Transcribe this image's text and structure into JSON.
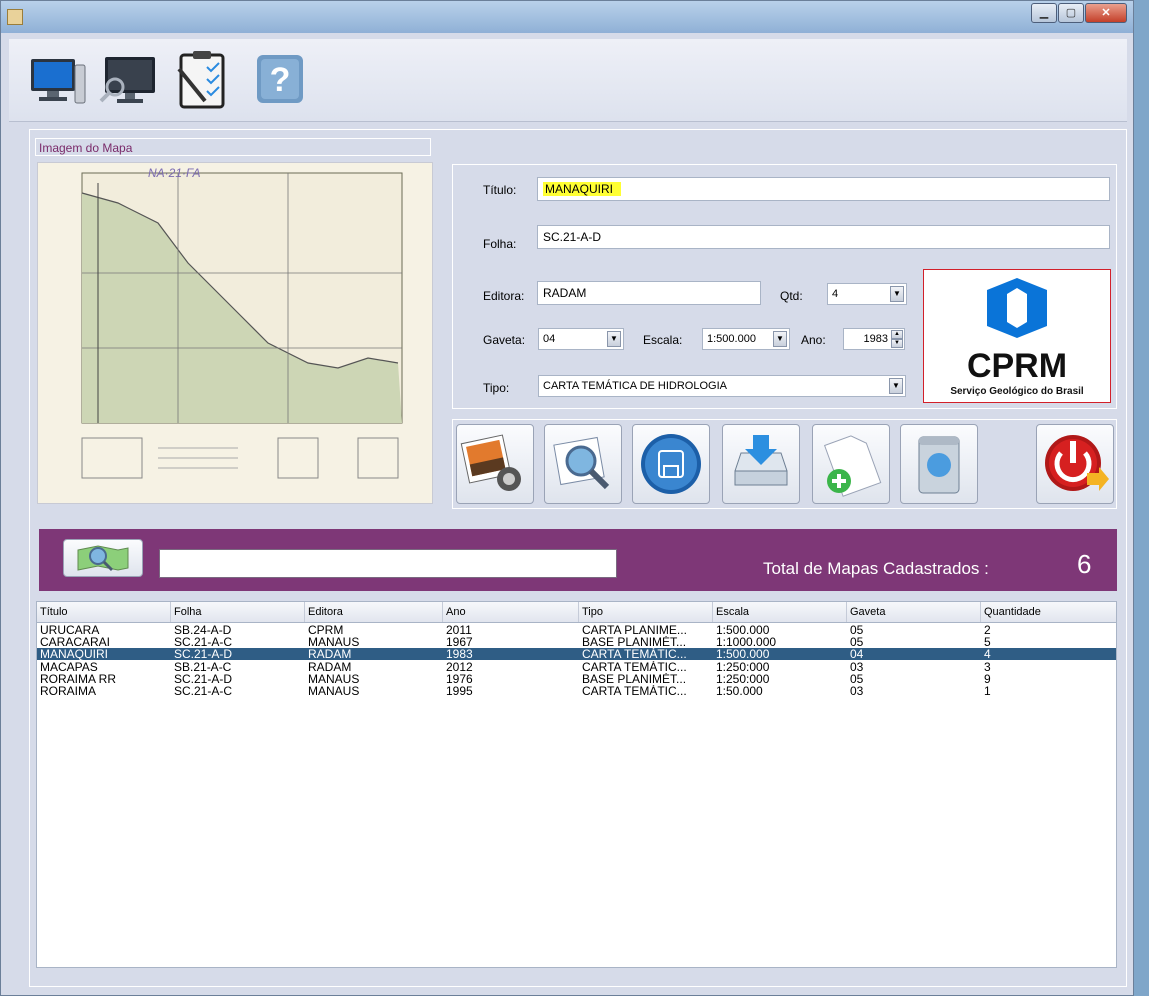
{
  "toolbar": {
    "icons": [
      "desktop-monitor-icon",
      "monitor-search-icon",
      "clipboard-checklist-icon",
      "help-icon"
    ]
  },
  "map_panel": {
    "label": "Imagem do Mapa",
    "sheet_code_handwritten": "NA·21·FA"
  },
  "form": {
    "titulo_label": "Título:",
    "titulo_value": "MANAQUIRI",
    "folha_label": "Folha:",
    "folha_value": "SC.21-A-D",
    "editora_label": "Editora:",
    "editora_value": "RADAM",
    "qtd_label": "Qtd:",
    "qtd_value": "4",
    "gaveta_label": "Gaveta:",
    "gaveta_value": "04",
    "escala_label": "Escala:",
    "escala_value": "1:500.000",
    "ano_label": "Ano:",
    "ano_value": "1983",
    "tipo_label": "Tipo:",
    "tipo_value": "CARTA TEMÁTICA DE HIDROLOGIA"
  },
  "logo": {
    "name": "CPRM",
    "subtitle": "Serviço Geológico do Brasil",
    "color": "#0a74d8"
  },
  "actions": [
    "image-camera-icon",
    "search-magnifier-icon",
    "save-floppy-icon",
    "download-tray-icon",
    "new-document-icon",
    "recycle-bin-icon",
    "power-exit-icon"
  ],
  "search": {
    "total_label": "Total de Mapas Cadastrados :",
    "total_value": "6",
    "bar_color": "#7e3777"
  },
  "table": {
    "columns": [
      "Título",
      "Folha",
      "Editora",
      "Ano",
      "Tipo",
      "Escala",
      "Gaveta",
      "Quantidade"
    ],
    "rows": [
      [
        "URUCARA",
        "SB.24-A-D",
        "CPRM",
        "2011",
        "CARTA PLANIME...",
        "1:500.000",
        "05",
        "2"
      ],
      [
        "CARACARAI",
        "SC.21-A-C",
        "MANAUS",
        "1967",
        "BASE PLANIMÉT...",
        "1:1000.000",
        "05",
        "5"
      ],
      [
        "MANAQUIRI",
        "SC.21-A-D",
        "RADAM",
        "1983",
        "CARTA TEMÁTIC...",
        "1:500.000",
        "04",
        "4"
      ],
      [
        "MACAPAS",
        "SB.21-A-C",
        "RADAM",
        "2012",
        "CARTA TEMÁTIC...",
        "1:250:000",
        "03",
        "3"
      ],
      [
        "RORAIMA RR",
        "SC.21-A-D",
        "MANAUS",
        "1976",
        "BASE PLANIMÉT...",
        "1:250:000",
        "05",
        "9"
      ],
      [
        "RORAIMA",
        "SC.21-A-C",
        "MANAUS",
        "1995",
        "CARTA TEMÁTIC...",
        "1:50.000",
        "03",
        "1"
      ]
    ],
    "selected_row": 2
  }
}
